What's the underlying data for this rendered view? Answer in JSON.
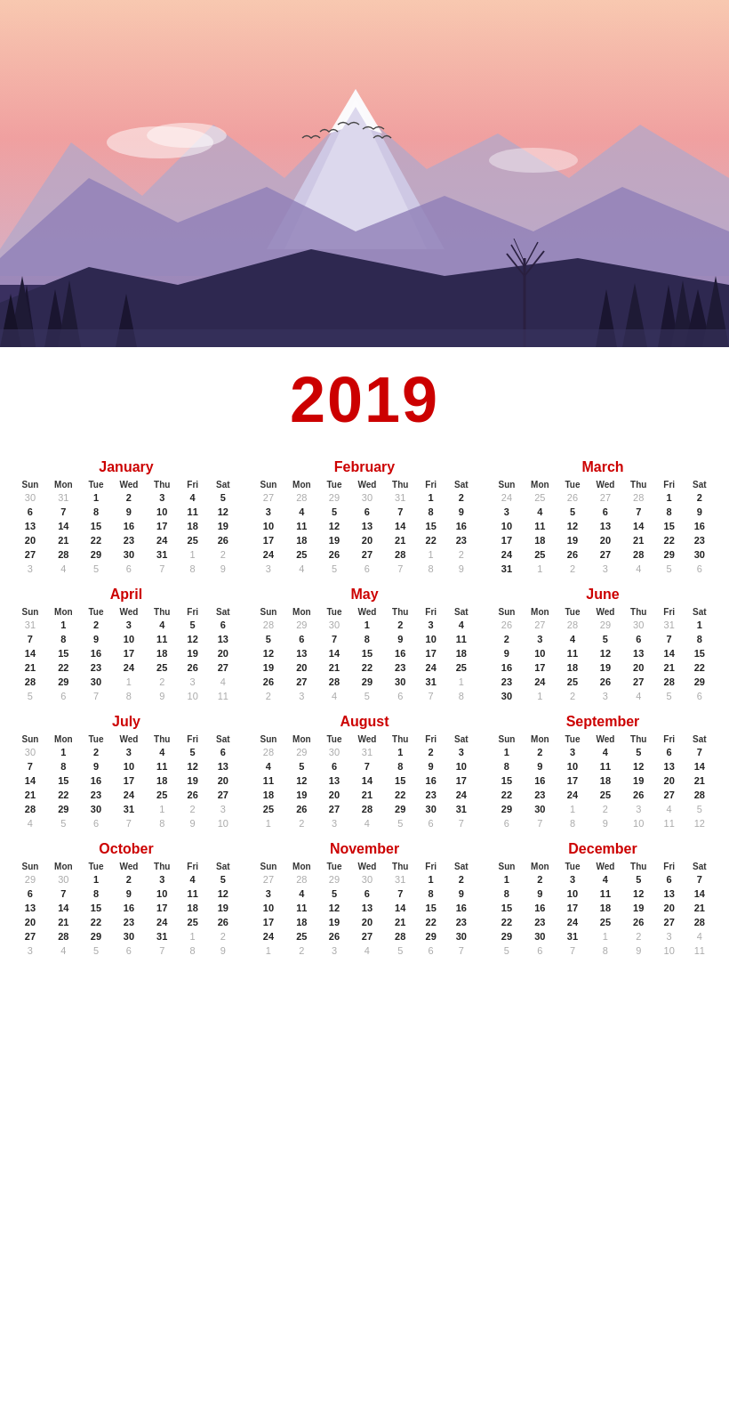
{
  "hero": {
    "alt": "Mountain landscape at dusk with forest silhouette"
  },
  "year": "2019",
  "months": [
    {
      "name": "January",
      "days_header": [
        "Sun",
        "Mon",
        "Tue",
        "Wed",
        "Thu",
        "Fri",
        "Sat"
      ],
      "weeks": [
        [
          "30",
          "31",
          "1",
          "2",
          "3",
          "4",
          "5"
        ],
        [
          "6",
          "7",
          "8",
          "9",
          "10",
          "11",
          "12"
        ],
        [
          "13",
          "14",
          "15",
          "16",
          "17",
          "18",
          "19"
        ],
        [
          "20",
          "21",
          "22",
          "23",
          "24",
          "25",
          "26"
        ],
        [
          "27",
          "28",
          "29",
          "30",
          "31",
          "1",
          "2"
        ],
        [
          "3",
          "4",
          "5",
          "6",
          "7",
          "8",
          "9"
        ]
      ],
      "dim_prev": [
        "30",
        "31"
      ],
      "dim_next": [
        "1",
        "2",
        "3",
        "4",
        "5",
        "6",
        "7",
        "8",
        "9"
      ]
    },
    {
      "name": "February",
      "days_header": [
        "Sun",
        "Mon",
        "Tue",
        "Wed",
        "Thu",
        "Fri",
        "Sat"
      ],
      "weeks": [
        [
          "27",
          "28",
          "29",
          "30",
          "31",
          "1",
          "2"
        ],
        [
          "3",
          "4",
          "5",
          "6",
          "7",
          "8",
          "9"
        ],
        [
          "10",
          "11",
          "12",
          "13",
          "14",
          "15",
          "16"
        ],
        [
          "17",
          "18",
          "19",
          "20",
          "21",
          "22",
          "23"
        ],
        [
          "24",
          "25",
          "26",
          "27",
          "28",
          "1",
          "2"
        ],
        [
          "3",
          "4",
          "5",
          "6",
          "7",
          "8",
          "9"
        ]
      ],
      "dim_prev": [
        "27",
        "28",
        "29",
        "30",
        "31"
      ],
      "dim_next": [
        "1",
        "2",
        "3",
        "4",
        "5",
        "6",
        "7",
        "8",
        "9"
      ]
    },
    {
      "name": "March",
      "days_header": [
        "Sun",
        "Mon",
        "Tue",
        "Wed",
        "Thu",
        "Fri",
        "Sat"
      ],
      "weeks": [
        [
          "24",
          "25",
          "26",
          "27",
          "28",
          "1",
          "2"
        ],
        [
          "3",
          "4",
          "5",
          "6",
          "7",
          "8",
          "9"
        ],
        [
          "10",
          "11",
          "12",
          "13",
          "14",
          "15",
          "16"
        ],
        [
          "17",
          "18",
          "19",
          "20",
          "21",
          "22",
          "23"
        ],
        [
          "24",
          "25",
          "26",
          "27",
          "28",
          "29",
          "30"
        ],
        [
          "31",
          "1",
          "2",
          "3",
          "4",
          "5",
          "6"
        ]
      ],
      "dim_prev": [
        "24",
        "25",
        "26",
        "27",
        "28"
      ],
      "dim_next": [
        "1",
        "2",
        "3",
        "4",
        "5",
        "6"
      ]
    },
    {
      "name": "April",
      "days_header": [
        "Sun",
        "Mon",
        "Tue",
        "Wed",
        "Thu",
        "Fri",
        "Sat"
      ],
      "weeks": [
        [
          "31",
          "1",
          "2",
          "3",
          "4",
          "5",
          "6"
        ],
        [
          "7",
          "8",
          "9",
          "10",
          "11",
          "12",
          "13"
        ],
        [
          "14",
          "15",
          "16",
          "17",
          "18",
          "19",
          "20"
        ],
        [
          "21",
          "22",
          "23",
          "24",
          "25",
          "26",
          "27"
        ],
        [
          "28",
          "29",
          "30",
          "1",
          "2",
          "3",
          "4"
        ],
        [
          "5",
          "6",
          "7",
          "8",
          "9",
          "10",
          "11"
        ]
      ],
      "dim_prev": [
        "31"
      ],
      "dim_next": [
        "1",
        "2",
        "3",
        "4",
        "5",
        "6",
        "7",
        "8",
        "9",
        "10",
        "11"
      ]
    },
    {
      "name": "May",
      "days_header": [
        "Sun",
        "Mon",
        "Tue",
        "Wed",
        "Thu",
        "Fri",
        "Sat"
      ],
      "weeks": [
        [
          "28",
          "29",
          "30",
          "1",
          "2",
          "3",
          "4"
        ],
        [
          "5",
          "6",
          "7",
          "8",
          "9",
          "10",
          "11"
        ],
        [
          "12",
          "13",
          "14",
          "15",
          "16",
          "17",
          "18"
        ],
        [
          "19",
          "20",
          "21",
          "22",
          "23",
          "24",
          "25"
        ],
        [
          "26",
          "27",
          "28",
          "29",
          "30",
          "31",
          "1"
        ],
        [
          "2",
          "3",
          "4",
          "5",
          "6",
          "7",
          "8"
        ]
      ],
      "dim_prev": [
        "28",
        "29",
        "30"
      ],
      "dim_next": [
        "1",
        "2",
        "3",
        "4",
        "5",
        "6",
        "7",
        "8"
      ]
    },
    {
      "name": "June",
      "days_header": [
        "Sun",
        "Mon",
        "Tue",
        "Wed",
        "Thu",
        "Fri",
        "Sat"
      ],
      "weeks": [
        [
          "26",
          "27",
          "28",
          "29",
          "30",
          "31",
          "1"
        ],
        [
          "2",
          "3",
          "4",
          "5",
          "6",
          "7",
          "8"
        ],
        [
          "9",
          "10",
          "11",
          "12",
          "13",
          "14",
          "15"
        ],
        [
          "16",
          "17",
          "18",
          "19",
          "20",
          "21",
          "22"
        ],
        [
          "23",
          "24",
          "25",
          "26",
          "27",
          "28",
          "29"
        ],
        [
          "30",
          "1",
          "2",
          "3",
          "4",
          "5",
          "6"
        ]
      ],
      "dim_prev": [
        "26",
        "27",
        "28",
        "29",
        "30",
        "31"
      ],
      "dim_next": [
        "1",
        "2",
        "3",
        "4",
        "5",
        "6"
      ]
    },
    {
      "name": "July",
      "days_header": [
        "Sun",
        "Mon",
        "Tue",
        "Wed",
        "Thu",
        "Fri",
        "Sat"
      ],
      "weeks": [
        [
          "30",
          "1",
          "2",
          "3",
          "4",
          "5",
          "6"
        ],
        [
          "7",
          "8",
          "9",
          "10",
          "11",
          "12",
          "13"
        ],
        [
          "14",
          "15",
          "16",
          "17",
          "18",
          "19",
          "20"
        ],
        [
          "21",
          "22",
          "23",
          "24",
          "25",
          "26",
          "27"
        ],
        [
          "28",
          "29",
          "30",
          "31",
          "1",
          "2",
          "3"
        ],
        [
          "4",
          "5",
          "6",
          "7",
          "8",
          "9",
          "10"
        ]
      ],
      "dim_prev": [
        "30"
      ],
      "dim_next": [
        "1",
        "2",
        "3",
        "4",
        "5",
        "6",
        "7",
        "8",
        "9",
        "10"
      ]
    },
    {
      "name": "August",
      "days_header": [
        "Sun",
        "Mon",
        "Tue",
        "Wed",
        "Thu",
        "Fri",
        "Sat"
      ],
      "weeks": [
        [
          "28",
          "29",
          "30",
          "31",
          "1",
          "2",
          "3"
        ],
        [
          "4",
          "5",
          "6",
          "7",
          "8",
          "9",
          "10"
        ],
        [
          "11",
          "12",
          "13",
          "14",
          "15",
          "16",
          "17"
        ],
        [
          "18",
          "19",
          "20",
          "21",
          "22",
          "23",
          "24"
        ],
        [
          "25",
          "26",
          "27",
          "28",
          "29",
          "30",
          "31"
        ],
        [
          "1",
          "2",
          "3",
          "4",
          "5",
          "6",
          "7"
        ]
      ],
      "dim_prev": [
        "28",
        "29",
        "30",
        "31"
      ],
      "dim_next": [
        "1",
        "2",
        "3",
        "4",
        "5",
        "6",
        "7"
      ]
    },
    {
      "name": "September",
      "days_header": [
        "Sun",
        "Mon",
        "Tue",
        "Wed",
        "Thu",
        "Fri",
        "Sat"
      ],
      "weeks": [
        [
          "1",
          "2",
          "3",
          "4",
          "5",
          "6",
          "7"
        ],
        [
          "8",
          "9",
          "10",
          "11",
          "12",
          "13",
          "14"
        ],
        [
          "15",
          "16",
          "17",
          "18",
          "19",
          "20",
          "21"
        ],
        [
          "22",
          "23",
          "24",
          "25",
          "26",
          "27",
          "28"
        ],
        [
          "29",
          "30",
          "1",
          "2",
          "3",
          "4",
          "5"
        ],
        [
          "6",
          "7",
          "8",
          "9",
          "10",
          "11",
          "12"
        ]
      ],
      "dim_prev": [],
      "dim_next": [
        "1",
        "2",
        "3",
        "4",
        "5",
        "6",
        "7",
        "8",
        "9",
        "10",
        "11",
        "12"
      ]
    },
    {
      "name": "October",
      "days_header": [
        "Sun",
        "Mon",
        "Tue",
        "Wed",
        "Thu",
        "Fri",
        "Sat"
      ],
      "weeks": [
        [
          "29",
          "30",
          "1",
          "2",
          "3",
          "4",
          "5"
        ],
        [
          "6",
          "7",
          "8",
          "9",
          "10",
          "11",
          "12"
        ],
        [
          "13",
          "14",
          "15",
          "16",
          "17",
          "18",
          "19"
        ],
        [
          "20",
          "21",
          "22",
          "23",
          "24",
          "25",
          "26"
        ],
        [
          "27",
          "28",
          "29",
          "30",
          "31",
          "1",
          "2"
        ],
        [
          "3",
          "4",
          "5",
          "6",
          "7",
          "8",
          "9"
        ]
      ],
      "dim_prev": [
        "29",
        "30"
      ],
      "dim_next": [
        "1",
        "2",
        "3",
        "4",
        "5",
        "6",
        "7",
        "8",
        "9"
      ]
    },
    {
      "name": "November",
      "days_header": [
        "Sun",
        "Mon",
        "Tue",
        "Wed",
        "Thu",
        "Fri",
        "Sat"
      ],
      "weeks": [
        [
          "27",
          "28",
          "29",
          "30",
          "31",
          "1",
          "2"
        ],
        [
          "3",
          "4",
          "5",
          "6",
          "7",
          "8",
          "9"
        ],
        [
          "10",
          "11",
          "12",
          "13",
          "14",
          "15",
          "16"
        ],
        [
          "17",
          "18",
          "19",
          "20",
          "21",
          "22",
          "23"
        ],
        [
          "24",
          "25",
          "26",
          "27",
          "28",
          "29",
          "30"
        ],
        [
          "1",
          "2",
          "3",
          "4",
          "5",
          "6",
          "7"
        ]
      ],
      "dim_prev": [
        "27",
        "28",
        "29",
        "30",
        "31"
      ],
      "dim_next": [
        "1",
        "2",
        "3",
        "4",
        "5",
        "6",
        "7"
      ]
    },
    {
      "name": "December",
      "days_header": [
        "Sun",
        "Mon",
        "Tue",
        "Wed",
        "Thu",
        "Fri",
        "Sat"
      ],
      "weeks": [
        [
          "1",
          "2",
          "3",
          "4",
          "5",
          "6",
          "7"
        ],
        [
          "8",
          "9",
          "10",
          "11",
          "12",
          "13",
          "14"
        ],
        [
          "15",
          "16",
          "17",
          "18",
          "19",
          "20",
          "21"
        ],
        [
          "22",
          "23",
          "24",
          "25",
          "26",
          "27",
          "28"
        ],
        [
          "29",
          "30",
          "31",
          "1",
          "2",
          "3",
          "4"
        ],
        [
          "5",
          "6",
          "7",
          "8",
          "9",
          "10",
          "11"
        ]
      ],
      "dim_prev": [],
      "dim_next": [
        "1",
        "2",
        "3",
        "4",
        "5",
        "6",
        "7",
        "8",
        "9",
        "10",
        "11"
      ]
    }
  ]
}
